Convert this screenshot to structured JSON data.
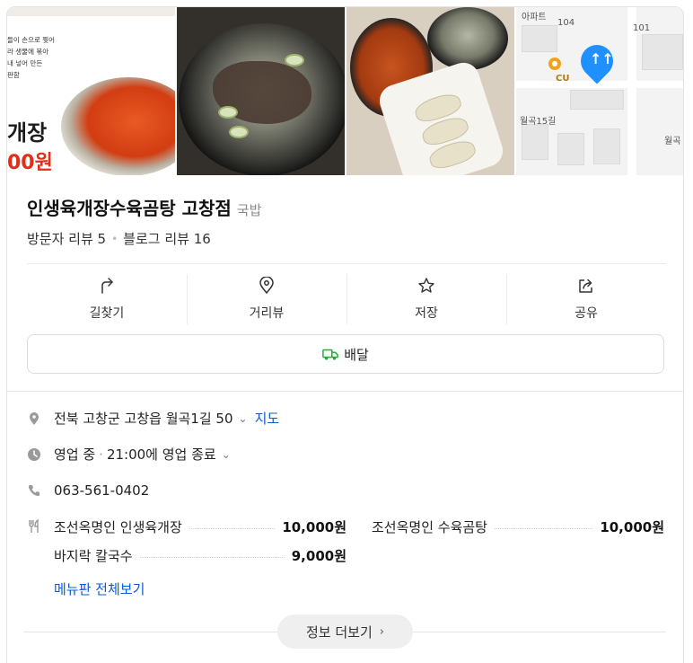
{
  "photos": {
    "ad_lines": [
      "들이 손으로 찢어",
      "라 생물에 볶아",
      "내 넣어 만든",
      "판함"
    ],
    "ad_big_text": "개장",
    "ad_price": "00원",
    "map": {
      "labels": [
        "아파트",
        "104",
        "101",
        "CU",
        "월곡15길",
        "월곡"
      ]
    }
  },
  "place": {
    "name": "인생육개장수육곰탕 고창점",
    "category": "국밥",
    "visitor_reviews": "방문자 리뷰 5",
    "blog_reviews": "블로그 리뷰 16"
  },
  "actions": [
    {
      "label": "길찾기",
      "icon": "directions-icon"
    },
    {
      "label": "거리뷰",
      "icon": "street-view-icon"
    },
    {
      "label": "저장",
      "icon": "star-icon"
    },
    {
      "label": "공유",
      "icon": "share-icon"
    }
  ],
  "delivery_label": "배달",
  "info": {
    "address": "전북 고창군 고창읍 월곡1길 50",
    "map_link": "지도",
    "status": "영업 중",
    "hours": "21:00에 영업 종료",
    "phone": "063-561-0402"
  },
  "menu": {
    "items": [
      {
        "name": "조선옥명인 인생육개장",
        "price": "10,000원"
      },
      {
        "name": "조선옥명인 수육곰탕",
        "price": "10,000원"
      },
      {
        "name": "바지락 칼국수",
        "price": "9,000원"
      }
    ],
    "view_all": "메뉴판 전체보기"
  },
  "more_info": "정보 더보기",
  "colors": {
    "link": "#0b5bd3",
    "delivery_green": "#1faa3a",
    "pin_blue": "#1e90ff"
  }
}
